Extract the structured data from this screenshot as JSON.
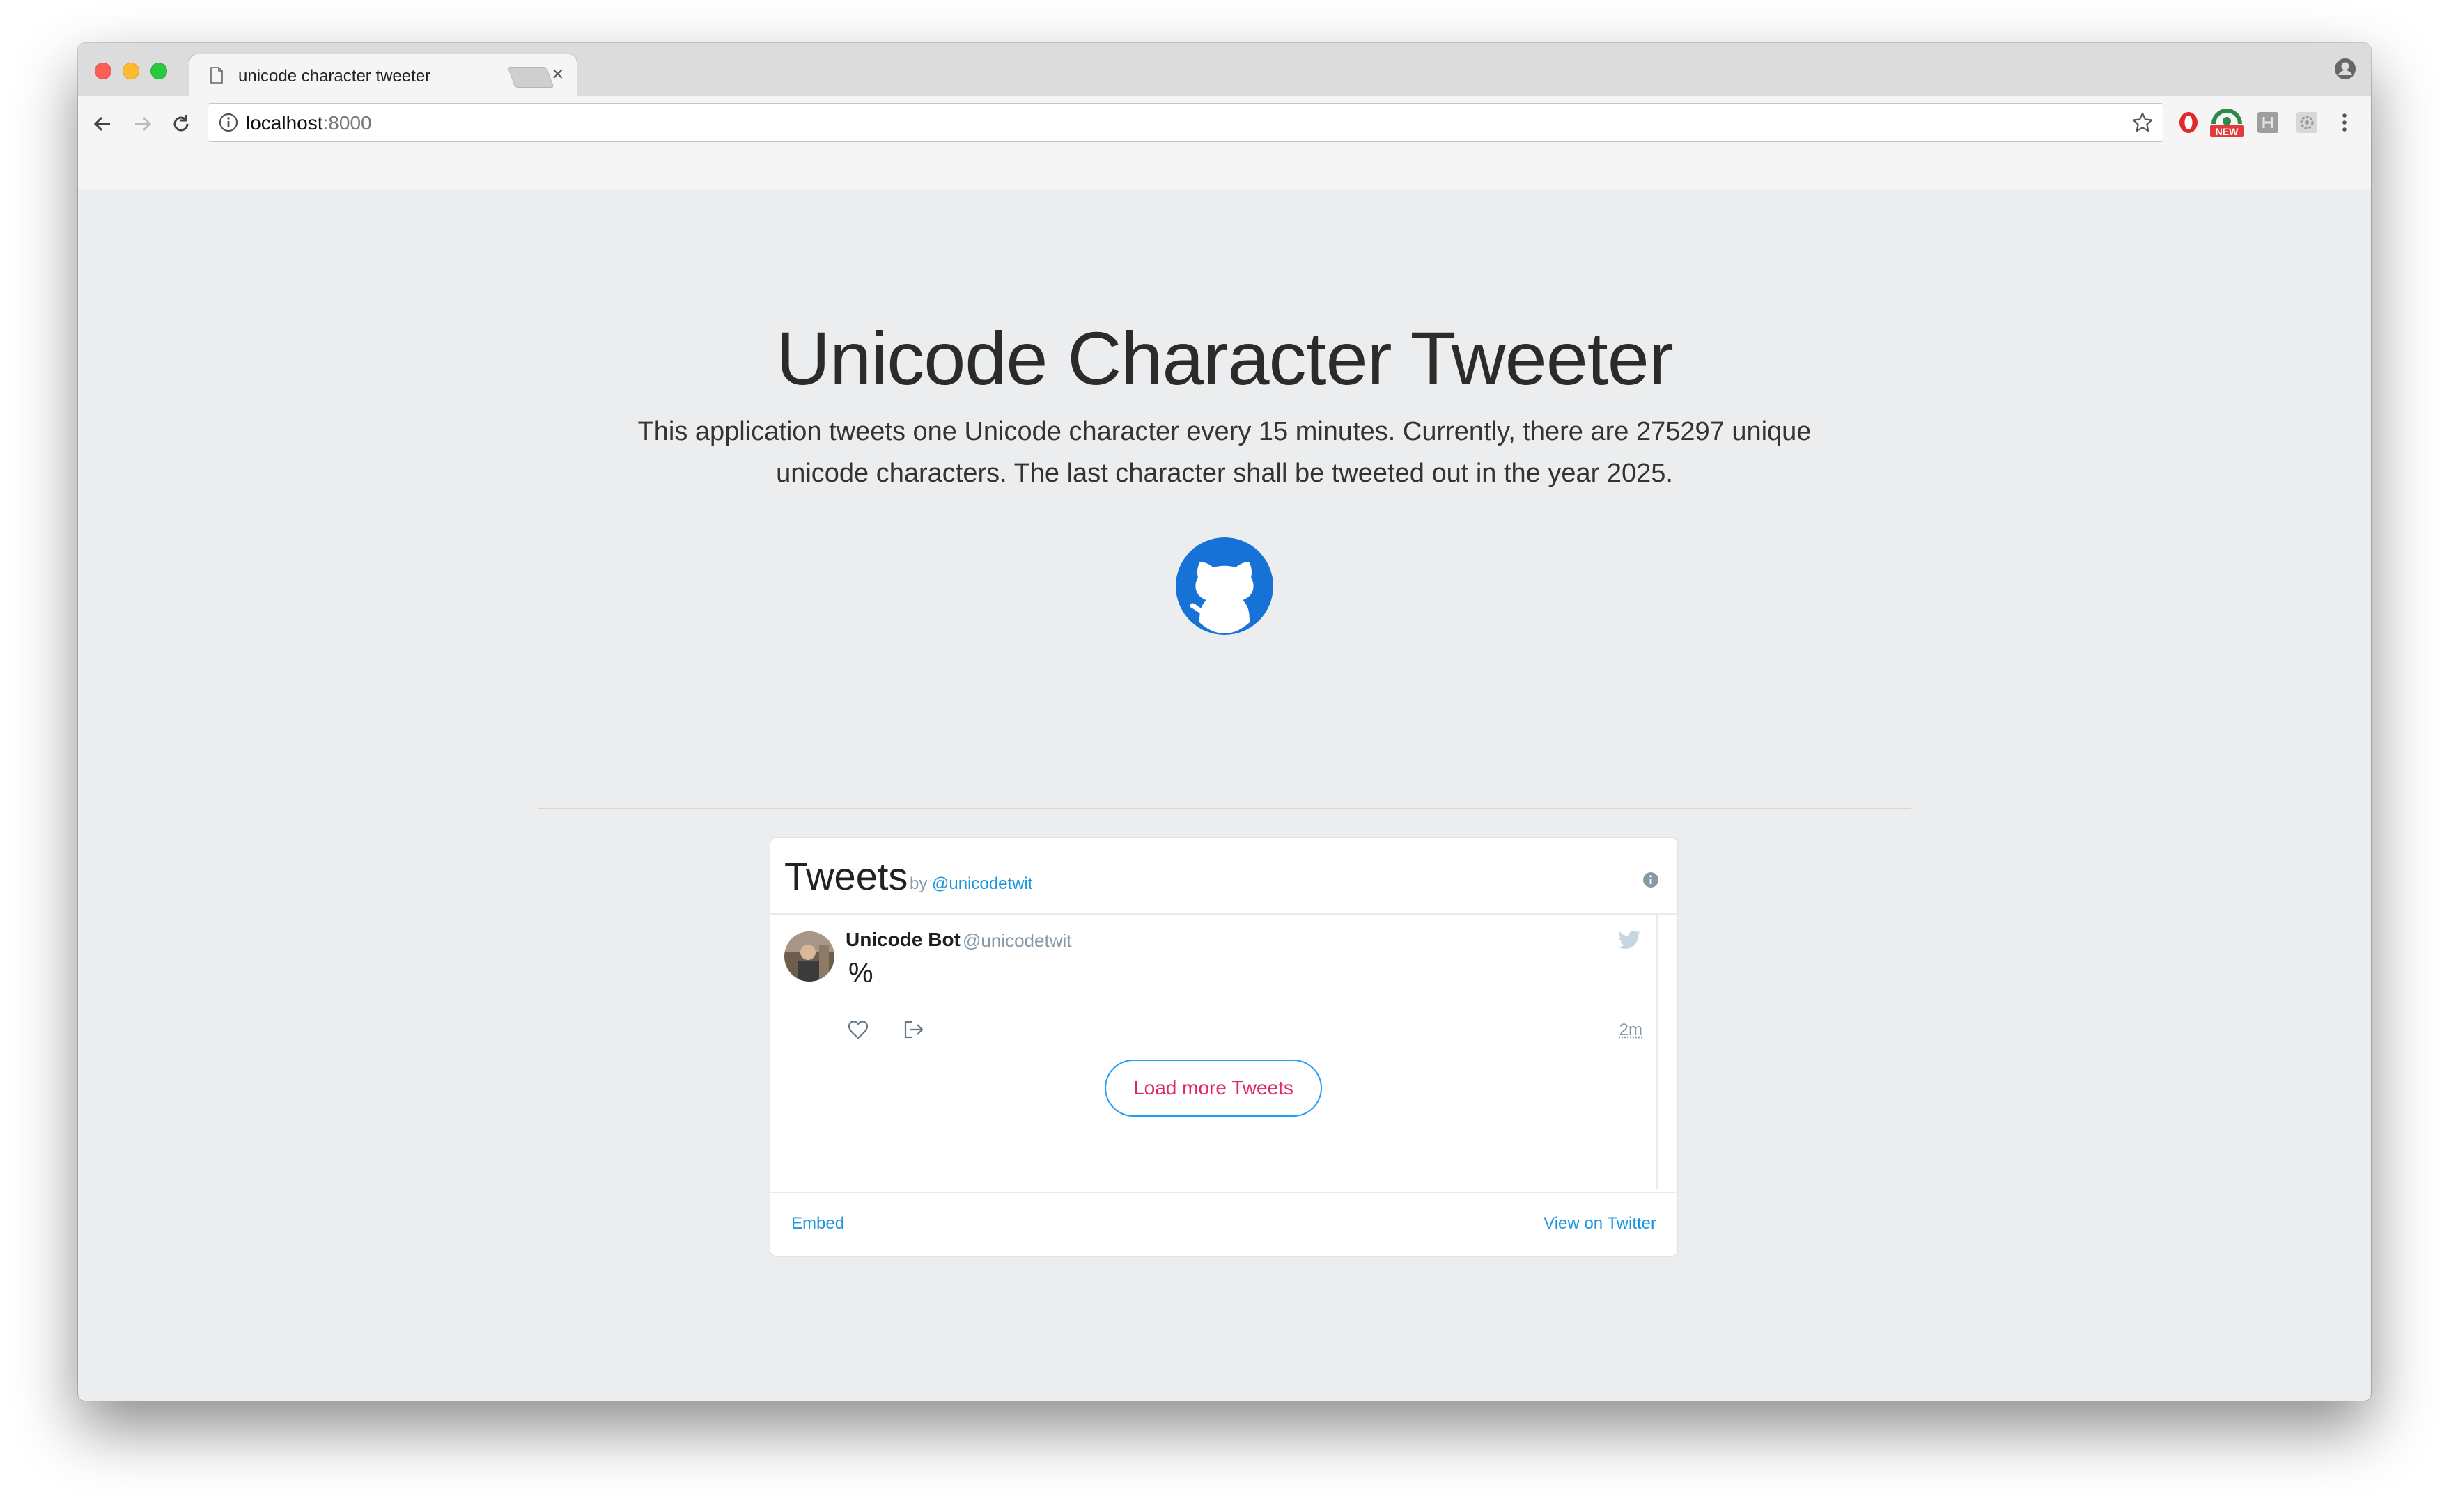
{
  "browser": {
    "tab_title": "unicode character tweeter",
    "tab_close": "×",
    "url_host": "localhost",
    "url_port": ":8000"
  },
  "page": {
    "title": "Unicode Character Tweeter",
    "description": "This application tweets one Unicode character every 15 minutes. Currently, there are 275297 unique unicode characters. The last character shall be tweeted out in the year 2025.",
    "github_icon": "github-octocat-icon",
    "accent_color": "#1672d6"
  },
  "widget": {
    "title": "Tweets",
    "by_prefix": "by",
    "by_handle": "@unicodetwit",
    "tweet": {
      "author_name": "Unicode Bot",
      "author_handle": "@unicodetwit",
      "text": "%",
      "time": "2m"
    },
    "load_more_label": "Load more Tweets",
    "embed_label": "Embed",
    "view_on_twitter_label": "View on Twitter",
    "link_color": "#1b95e0",
    "button_text_color": "#e0245e"
  }
}
